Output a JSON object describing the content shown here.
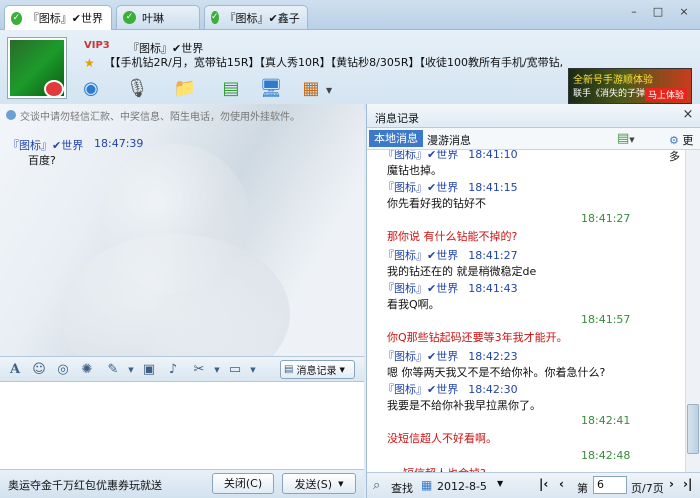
{
  "tabs": [
    {
      "label": "『图标』✔世界",
      "active": true
    },
    {
      "label": "叶琳",
      "active": false
    },
    {
      "label": "『图标』✔鑫子",
      "active": false
    }
  ],
  "window": {
    "min": "–",
    "max": "□",
    "close": "×"
  },
  "contact": {
    "vip_badge": "VIP3",
    "nickname": "『图标』✔世界",
    "signature": "【【手机钻2R/月，宽带钻15R】【真人秀10R】【黄钻秒8/305R】【收徒100教所有手机/宽带钻,图标,软件技术】"
  },
  "ad": {
    "line1": "全新号手游顺体验",
    "line2": "联手《消失的子弹》",
    "cta": "马上体验"
  },
  "chat": {
    "warning": "交谈中请勿轻信汇款、中奖信息、陌生电话，勿使用外挂软件。",
    "messages": [
      {
        "name": "『图标』✔世界",
        "time": "18:47:39",
        "text": "百度?"
      }
    ]
  },
  "toolbar": {
    "history_label": "消息记录"
  },
  "bottom": {
    "promo": "奥运夺金千万红包优惠券玩就送",
    "close_label": "关闭(C)",
    "send_label": "发送(S)"
  },
  "history": {
    "title": "消息记录",
    "tab_local": "本地消息",
    "tab_roam": "漫游消息",
    "more_label": "更多",
    "lines": [
      {
        "kind": "head",
        "name": "『图标』✔世界",
        "time": "18:41:10"
      },
      {
        "kind": "text",
        "text": "魔钻也掉。"
      },
      {
        "kind": "head",
        "name": "『图标』✔世界",
        "time": "18:41:15"
      },
      {
        "kind": "text",
        "text": "你先看好我的钻好不"
      },
      {
        "kind": "mytime",
        "time": "18:41:27"
      },
      {
        "kind": "mytext",
        "text": "那你说  有什么钻能不掉的?"
      },
      {
        "kind": "head",
        "name": "『图标』✔世界",
        "time": "18:41:27"
      },
      {
        "kind": "text",
        "text": "我的钻还在的  就是稍微稳定de"
      },
      {
        "kind": "head",
        "name": "『图标』✔世界",
        "time": "18:41:43"
      },
      {
        "kind": "text",
        "text": "看我Q啊。"
      },
      {
        "kind": "mytime",
        "time": "18:41:57"
      },
      {
        "kind": "mytext",
        "text": "你Q那些钻起码还要等3年我才能开。"
      },
      {
        "kind": "head",
        "name": "『图标』✔世界",
        "time": "18:42:23"
      },
      {
        "kind": "text",
        "text": "嗯  你等两天我又不是不给你补。你着急什么?"
      },
      {
        "kind": "head",
        "name": "『图标』✔世界",
        "time": "18:42:30"
      },
      {
        "kind": "text",
        "text": "我要是不给你补我早拉黑你了。"
      },
      {
        "kind": "mytime",
        "time": "18:42:41"
      },
      {
        "kind": "mytext",
        "text": "没短信超人不好看啊。"
      },
      {
        "kind": "mytime",
        "time": "18:42:48"
      },
      {
        "kind": "mytext2",
        "text": "短信超人也会掉?"
      }
    ],
    "find_label": "查找",
    "date": "2012-8-5",
    "page_label": "第",
    "page": "6",
    "page_total": "页/7页"
  }
}
